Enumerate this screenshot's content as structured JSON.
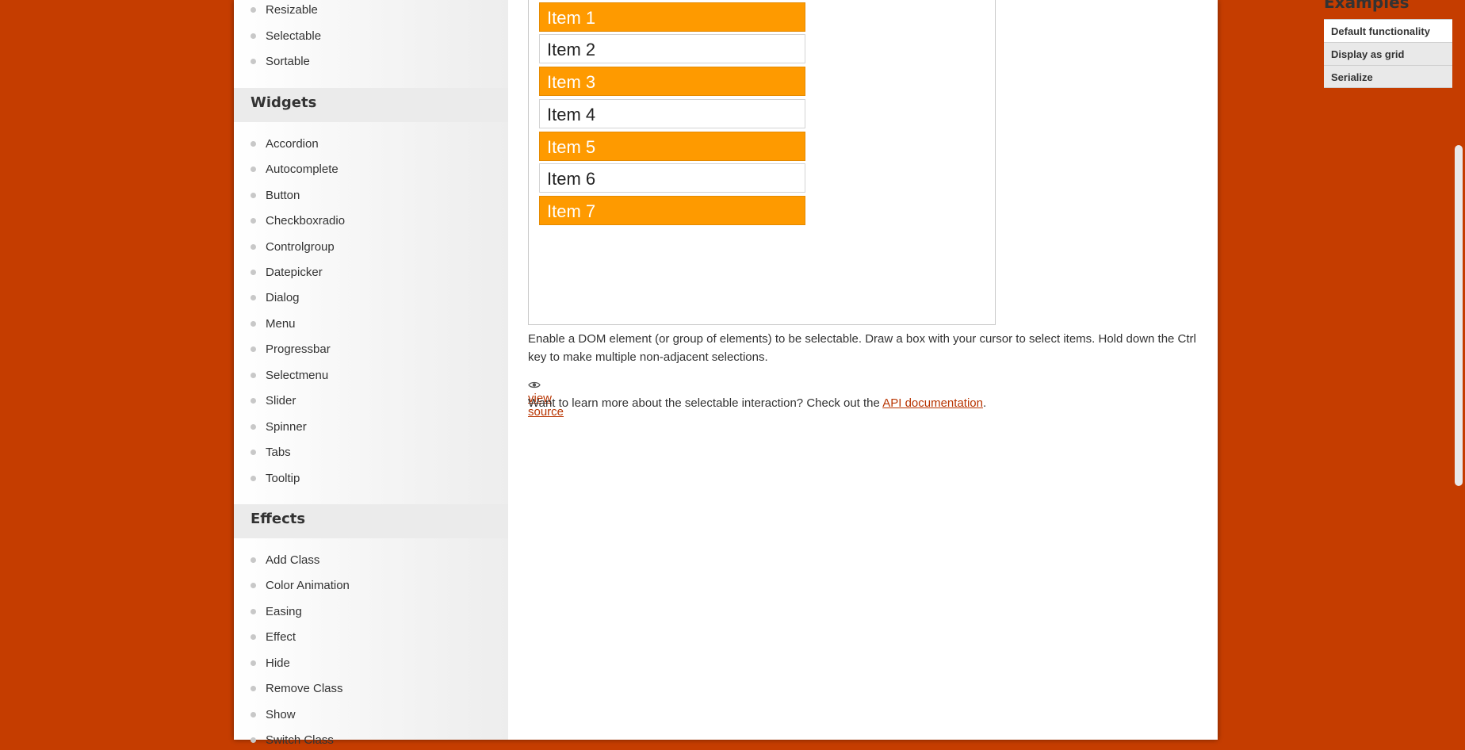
{
  "sidebar": {
    "interactions_items": [
      "Resizable",
      "Selectable",
      "Sortable"
    ],
    "widgets_heading": "Widgets",
    "widgets_items": [
      "Accordion",
      "Autocomplete",
      "Button",
      "Checkboxradio",
      "Controlgroup",
      "Datepicker",
      "Dialog",
      "Menu",
      "Progressbar",
      "Selectmenu",
      "Slider",
      "Spinner",
      "Tabs",
      "Tooltip"
    ],
    "effects_heading": "Effects",
    "effects_items": [
      "Add Class",
      "Color Animation",
      "Easing",
      "Effect",
      "Hide",
      "Remove Class",
      "Show",
      "Switch Class"
    ]
  },
  "demo": {
    "items": [
      {
        "label": "Item 1",
        "selected": true
      },
      {
        "label": "Item 2",
        "selected": false
      },
      {
        "label": "Item 3",
        "selected": true
      },
      {
        "label": "Item 4",
        "selected": false
      },
      {
        "label": "Item 5",
        "selected": true
      },
      {
        "label": "Item 6",
        "selected": false
      },
      {
        "label": "Item 7",
        "selected": true
      }
    ]
  },
  "main": {
    "description": "Enable a DOM element (or group of elements) to be selectable. Draw a box with your cursor to select items. Hold down the Ctrl key to make multiple non-adjacent selections.",
    "view_source": "view source",
    "learn_more_prefix": "Want to learn more about the selectable interaction? Check out the",
    "api_link": "API documentation",
    "learn_more_suffix": "."
  },
  "examples": {
    "heading": "Examples",
    "items": [
      "Default functionality",
      "Display as grid",
      "Serialize"
    ]
  },
  "colors": {
    "background": "#c53d00",
    "selected_item": "#fe9a00",
    "link": "#b83400"
  },
  "icons": {
    "view_source": "eye-icon",
    "nav_bullet": "bullet-dot"
  }
}
